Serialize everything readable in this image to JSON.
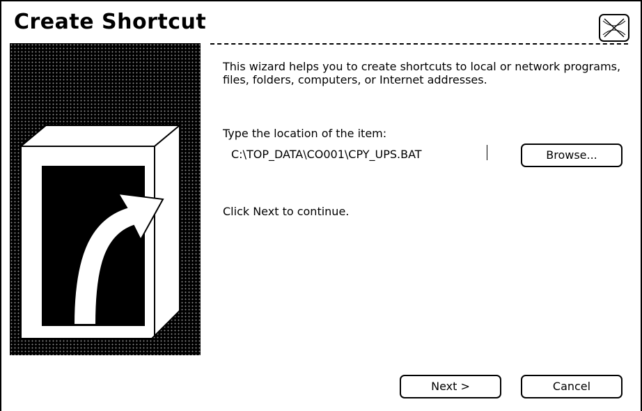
{
  "window": {
    "title": "Create Shortcut"
  },
  "wizard": {
    "intro": "This wizard helps you to create shortcuts to local or network programs, files, folders, computers, or Internet addresses.",
    "location_label": "Type the location of the item:",
    "location_value": "C:\\TOP_DATA\\CO001\\CPY_UPS.BAT",
    "continue_hint": "Click Next to continue."
  },
  "buttons": {
    "browse": "Browse...",
    "next": "Next >",
    "cancel": "Cancel"
  },
  "icons": {
    "close": "close-icon",
    "banner": "shortcut-arrow-icon"
  }
}
